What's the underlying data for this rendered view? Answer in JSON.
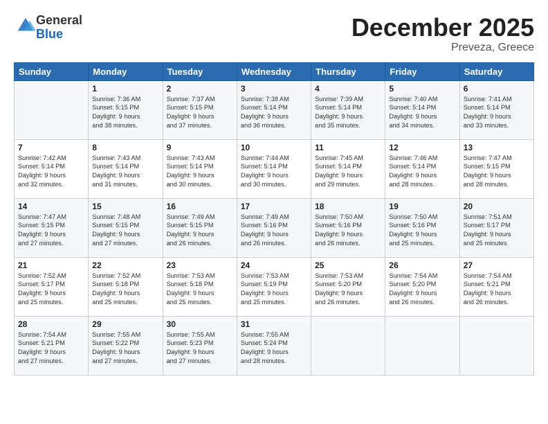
{
  "logo": {
    "general": "General",
    "blue": "Blue"
  },
  "title": "December 2025",
  "location": "Preveza, Greece",
  "days_of_week": [
    "Sunday",
    "Monday",
    "Tuesday",
    "Wednesday",
    "Thursday",
    "Friday",
    "Saturday"
  ],
  "weeks": [
    [
      {
        "day": "",
        "sunrise": "",
        "sunset": "",
        "daylight": ""
      },
      {
        "day": "1",
        "sunrise": "Sunrise: 7:36 AM",
        "sunset": "Sunset: 5:15 PM",
        "daylight": "Daylight: 9 hours and 38 minutes."
      },
      {
        "day": "2",
        "sunrise": "Sunrise: 7:37 AM",
        "sunset": "Sunset: 5:15 PM",
        "daylight": "Daylight: 9 hours and 37 minutes."
      },
      {
        "day": "3",
        "sunrise": "Sunrise: 7:38 AM",
        "sunset": "Sunset: 5:14 PM",
        "daylight": "Daylight: 9 hours and 36 minutes."
      },
      {
        "day": "4",
        "sunrise": "Sunrise: 7:39 AM",
        "sunset": "Sunset: 5:14 PM",
        "daylight": "Daylight: 9 hours and 35 minutes."
      },
      {
        "day": "5",
        "sunrise": "Sunrise: 7:40 AM",
        "sunset": "Sunset: 5:14 PM",
        "daylight": "Daylight: 9 hours and 34 minutes."
      },
      {
        "day": "6",
        "sunrise": "Sunrise: 7:41 AM",
        "sunset": "Sunset: 5:14 PM",
        "daylight": "Daylight: 9 hours and 33 minutes."
      }
    ],
    [
      {
        "day": "7",
        "sunrise": "Sunrise: 7:42 AM",
        "sunset": "Sunset: 5:14 PM",
        "daylight": "Daylight: 9 hours and 32 minutes."
      },
      {
        "day": "8",
        "sunrise": "Sunrise: 7:43 AM",
        "sunset": "Sunset: 5:14 PM",
        "daylight": "Daylight: 9 hours and 31 minutes."
      },
      {
        "day": "9",
        "sunrise": "Sunrise: 7:43 AM",
        "sunset": "Sunset: 5:14 PM",
        "daylight": "Daylight: 9 hours and 30 minutes."
      },
      {
        "day": "10",
        "sunrise": "Sunrise: 7:44 AM",
        "sunset": "Sunset: 5:14 PM",
        "daylight": "Daylight: 9 hours and 30 minutes."
      },
      {
        "day": "11",
        "sunrise": "Sunrise: 7:45 AM",
        "sunset": "Sunset: 5:14 PM",
        "daylight": "Daylight: 9 hours and 29 minutes."
      },
      {
        "day": "12",
        "sunrise": "Sunrise: 7:46 AM",
        "sunset": "Sunset: 5:14 PM",
        "daylight": "Daylight: 9 hours and 28 minutes."
      },
      {
        "day": "13",
        "sunrise": "Sunrise: 7:47 AM",
        "sunset": "Sunset: 5:15 PM",
        "daylight": "Daylight: 9 hours and 28 minutes."
      }
    ],
    [
      {
        "day": "14",
        "sunrise": "Sunrise: 7:47 AM",
        "sunset": "Sunset: 5:15 PM",
        "daylight": "Daylight: 9 hours and 27 minutes."
      },
      {
        "day": "15",
        "sunrise": "Sunrise: 7:48 AM",
        "sunset": "Sunset: 5:15 PM",
        "daylight": "Daylight: 9 hours and 27 minutes."
      },
      {
        "day": "16",
        "sunrise": "Sunrise: 7:49 AM",
        "sunset": "Sunset: 5:15 PM",
        "daylight": "Daylight: 9 hours and 26 minutes."
      },
      {
        "day": "17",
        "sunrise": "Sunrise: 7:49 AM",
        "sunset": "Sunset: 5:16 PM",
        "daylight": "Daylight: 9 hours and 26 minutes."
      },
      {
        "day": "18",
        "sunrise": "Sunrise: 7:50 AM",
        "sunset": "Sunset: 5:16 PM",
        "daylight": "Daylight: 9 hours and 26 minutes."
      },
      {
        "day": "19",
        "sunrise": "Sunrise: 7:50 AM",
        "sunset": "Sunset: 5:16 PM",
        "daylight": "Daylight: 9 hours and 25 minutes."
      },
      {
        "day": "20",
        "sunrise": "Sunrise: 7:51 AM",
        "sunset": "Sunset: 5:17 PM",
        "daylight": "Daylight: 9 hours and 25 minutes."
      }
    ],
    [
      {
        "day": "21",
        "sunrise": "Sunrise: 7:52 AM",
        "sunset": "Sunset: 5:17 PM",
        "daylight": "Daylight: 9 hours and 25 minutes."
      },
      {
        "day": "22",
        "sunrise": "Sunrise: 7:52 AM",
        "sunset": "Sunset: 5:18 PM",
        "daylight": "Daylight: 9 hours and 25 minutes."
      },
      {
        "day": "23",
        "sunrise": "Sunrise: 7:53 AM",
        "sunset": "Sunset: 5:18 PM",
        "daylight": "Daylight: 9 hours and 25 minutes."
      },
      {
        "day": "24",
        "sunrise": "Sunrise: 7:53 AM",
        "sunset": "Sunset: 5:19 PM",
        "daylight": "Daylight: 9 hours and 25 minutes."
      },
      {
        "day": "25",
        "sunrise": "Sunrise: 7:53 AM",
        "sunset": "Sunset: 5:20 PM",
        "daylight": "Daylight: 9 hours and 26 minutes."
      },
      {
        "day": "26",
        "sunrise": "Sunrise: 7:54 AM",
        "sunset": "Sunset: 5:20 PM",
        "daylight": "Daylight: 9 hours and 26 minutes."
      },
      {
        "day": "27",
        "sunrise": "Sunrise: 7:54 AM",
        "sunset": "Sunset: 5:21 PM",
        "daylight": "Daylight: 9 hours and 26 minutes."
      }
    ],
    [
      {
        "day": "28",
        "sunrise": "Sunrise: 7:54 AM",
        "sunset": "Sunset: 5:21 PM",
        "daylight": "Daylight: 9 hours and 27 minutes."
      },
      {
        "day": "29",
        "sunrise": "Sunrise: 7:55 AM",
        "sunset": "Sunset: 5:22 PM",
        "daylight": "Daylight: 9 hours and 27 minutes."
      },
      {
        "day": "30",
        "sunrise": "Sunrise: 7:55 AM",
        "sunset": "Sunset: 5:23 PM",
        "daylight": "Daylight: 9 hours and 27 minutes."
      },
      {
        "day": "31",
        "sunrise": "Sunrise: 7:55 AM",
        "sunset": "Sunset: 5:24 PM",
        "daylight": "Daylight: 9 hours and 28 minutes."
      },
      {
        "day": "",
        "sunrise": "",
        "sunset": "",
        "daylight": ""
      },
      {
        "day": "",
        "sunrise": "",
        "sunset": "",
        "daylight": ""
      },
      {
        "day": "",
        "sunrise": "",
        "sunset": "",
        "daylight": ""
      }
    ]
  ]
}
